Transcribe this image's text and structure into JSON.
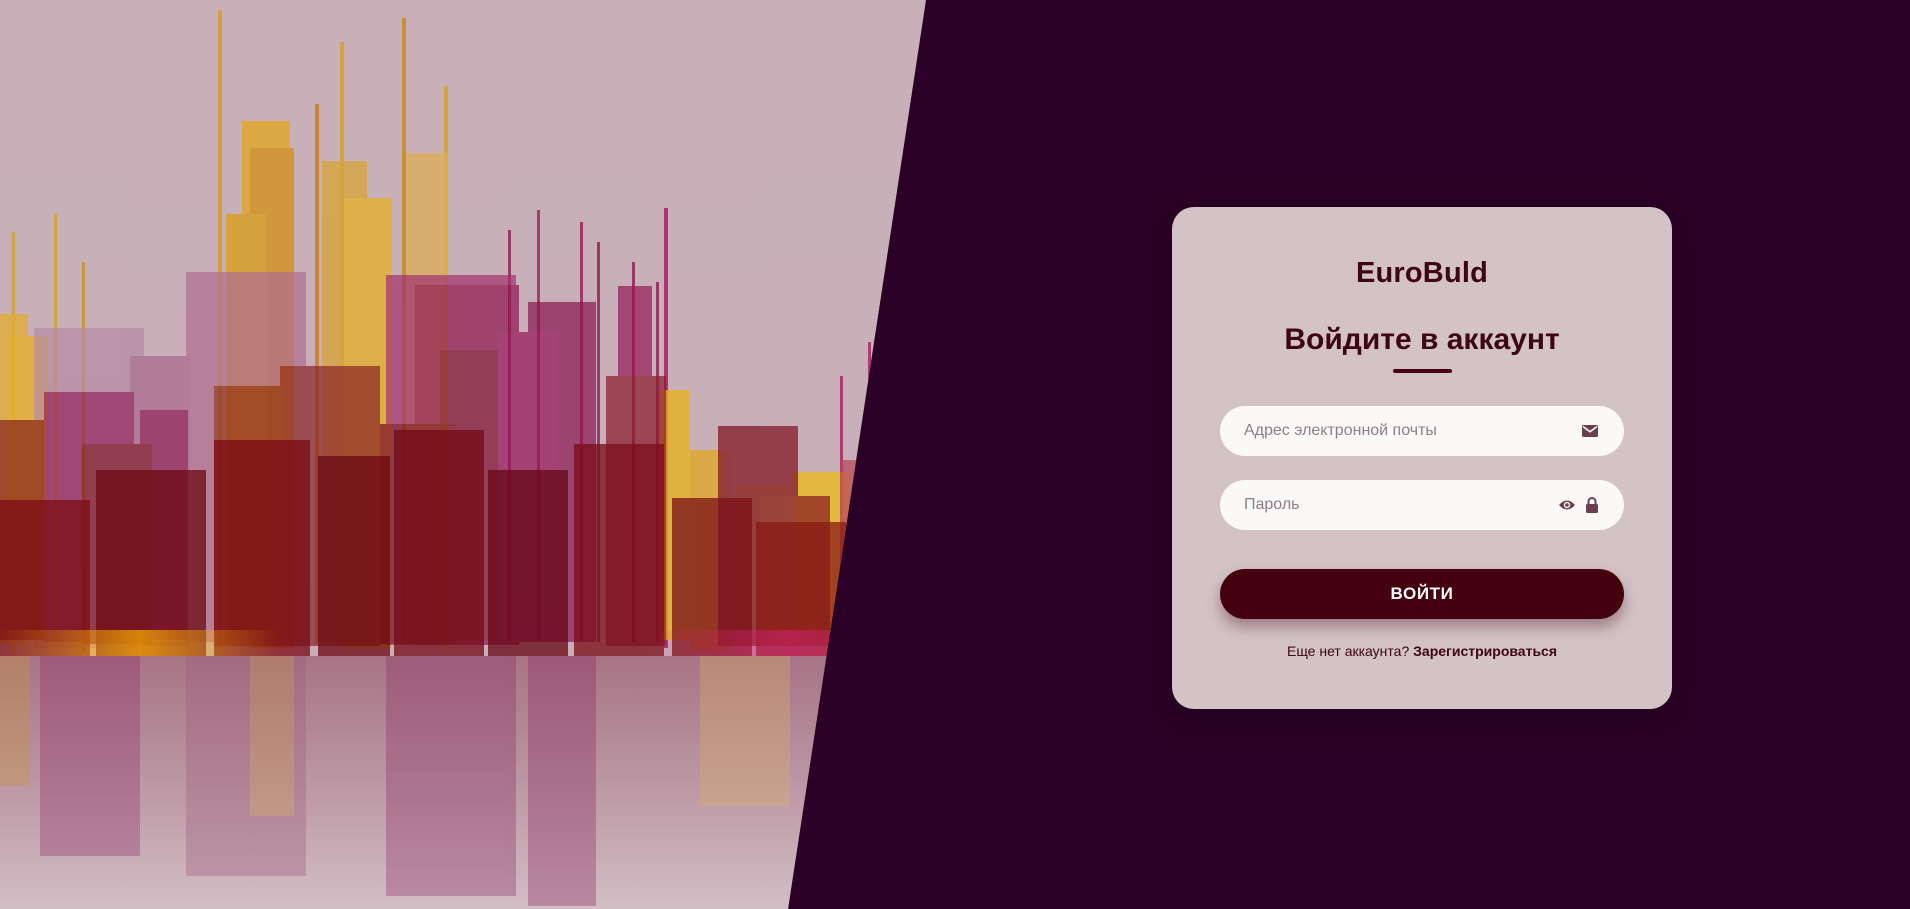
{
  "brand": {
    "name": "EuroBuld"
  },
  "login": {
    "heading": "Войдите в аккаунт",
    "email_placeholder": "Адрес электронной почты",
    "password_placeholder": "Пароль",
    "submit_label": "ВОЙТИ",
    "signup_prompt": "Еще нет аккаунта?",
    "signup_link": "Зарегистрироваться"
  },
  "icons": {
    "email": "envelope-icon",
    "show_password": "eye-icon",
    "password": "lock-icon"
  },
  "colors": {
    "background": "#2b0026",
    "card": "#d3c2c6",
    "accent": "#45000f",
    "text": "#3e0515"
  }
}
